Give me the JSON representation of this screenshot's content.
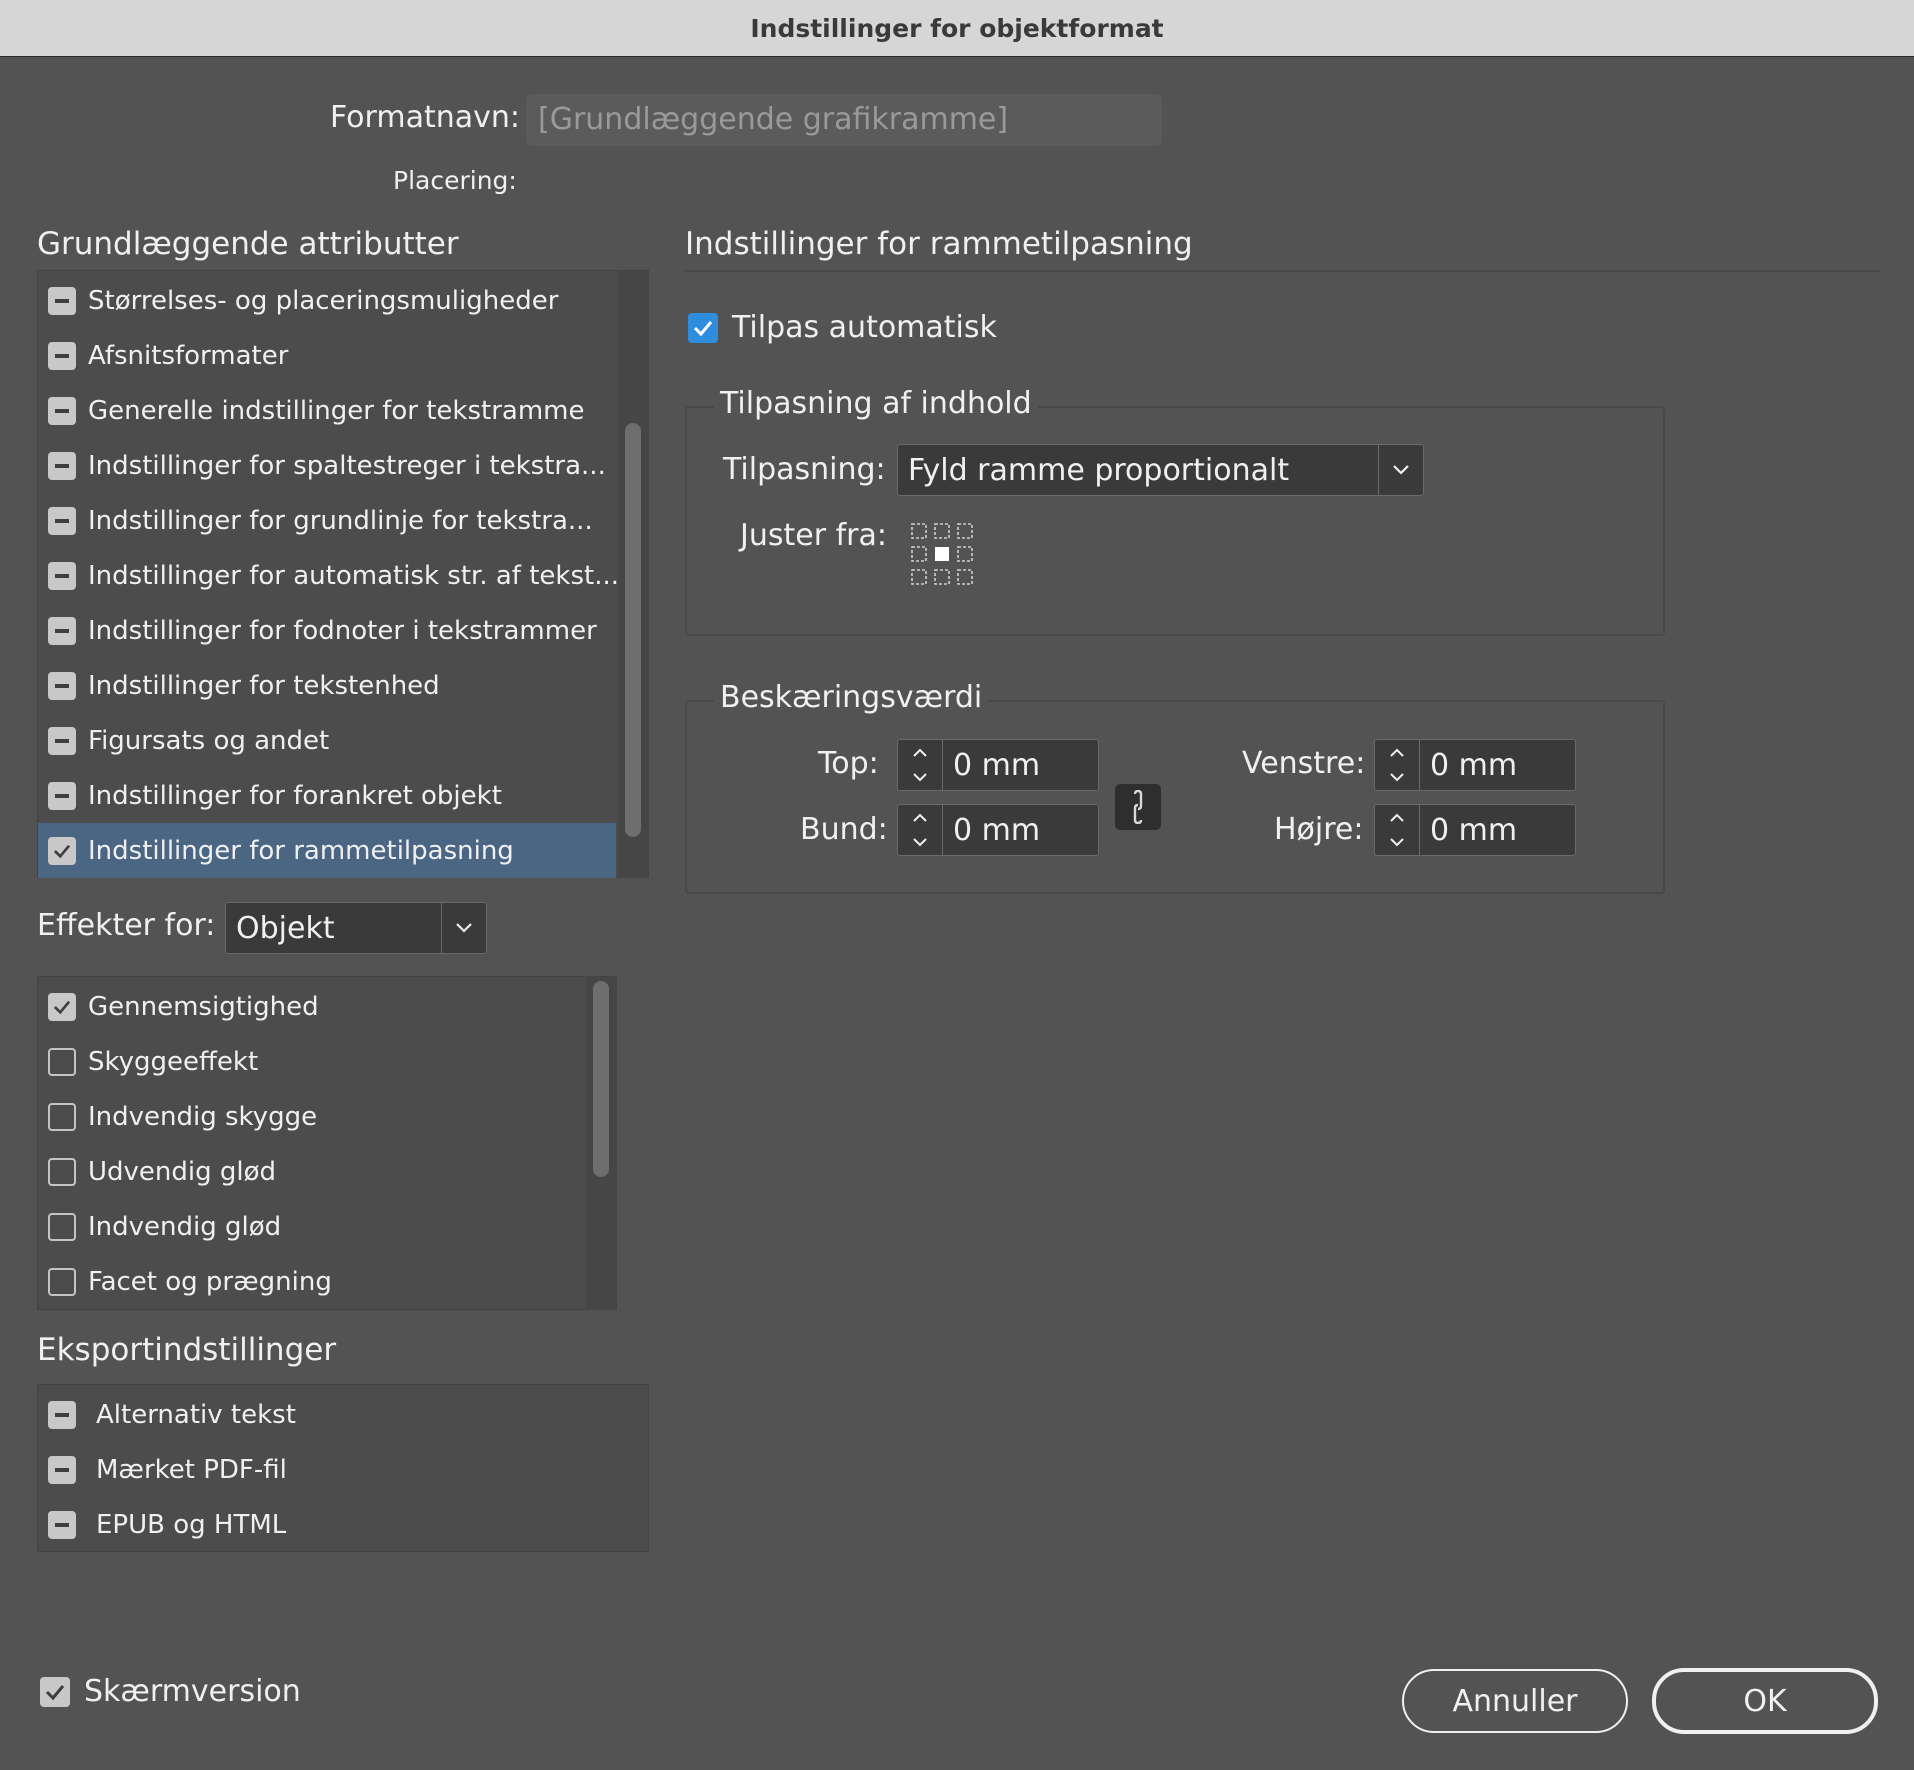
{
  "window": {
    "title": "Indstillinger for objektformat"
  },
  "format": {
    "name_label": "Formatnavn:",
    "name_value": "[Grundlæggende grafikramme]",
    "location_label": "Placering:"
  },
  "basic_attributes": {
    "heading": "Grundlæggende attributter",
    "items": [
      {
        "label": "Størrelses- og placeringsmuligheder",
        "state": "ignored"
      },
      {
        "label": "Afsnitsformater",
        "state": "ignored"
      },
      {
        "label": "Generelle indstillinger for tekstramme",
        "state": "ignored"
      },
      {
        "label": "Indstillinger for spaltestreger i tekstra...",
        "state": "ignored"
      },
      {
        "label": "Indstillinger for grundlinje for tekstra...",
        "state": "ignored"
      },
      {
        "label": "Indstillinger for automatisk str. af tekst...",
        "state": "ignored"
      },
      {
        "label": "Indstillinger for fodnoter i tekstrammer",
        "state": "ignored"
      },
      {
        "label": "Indstillinger for tekstenhed",
        "state": "ignored"
      },
      {
        "label": "Figursats og andet",
        "state": "ignored"
      },
      {
        "label": "Indstillinger for forankret objekt",
        "state": "ignored"
      },
      {
        "label": "Indstillinger for rammetilpasning",
        "state": "checked",
        "selected": true
      }
    ]
  },
  "effects": {
    "label": "Effekter for:",
    "selected": "Objekt",
    "items": [
      {
        "label": "Gennemsigtighed",
        "checked": true
      },
      {
        "label": "Skyggeeffekt",
        "checked": false
      },
      {
        "label": "Indvendig skygge",
        "checked": false
      },
      {
        "label": "Udvendig glød",
        "checked": false
      },
      {
        "label": "Indvendig glød",
        "checked": false
      },
      {
        "label": "Facet og prægning",
        "checked": false
      }
    ]
  },
  "export": {
    "heading": "Eksportindstillinger",
    "items": [
      {
        "label": "Alternativ tekst"
      },
      {
        "label": "Mærket PDF-fil"
      },
      {
        "label": "EPUB og HTML"
      }
    ]
  },
  "frame_fitting": {
    "heading": "Indstillinger for rammetilpasning",
    "auto_fit_label": "Tilpas automatisk",
    "auto_fit_checked": true,
    "content_group": {
      "title": "Tilpasning af indhold",
      "fitting_label": "Tilpasning:",
      "fitting_value": "Fyld ramme proportionalt",
      "align_label": "Juster fra:"
    },
    "crop_group": {
      "title": "Beskæringsværdi",
      "top_label": "Top:",
      "top_value": "0 mm",
      "bottom_label": "Bund:",
      "bottom_value": "0 mm",
      "left_label": "Venstre:",
      "left_value": "0 mm",
      "right_label": "Højre:",
      "right_value": "0 mm"
    }
  },
  "footer": {
    "screen_version_label": "Skærmversion",
    "screen_version_checked": true,
    "cancel_label": "Annuller",
    "ok_label": "OK"
  },
  "colors": {
    "background": "#535353",
    "selection": "#4a6683",
    "accent": "#2f8ddf"
  }
}
